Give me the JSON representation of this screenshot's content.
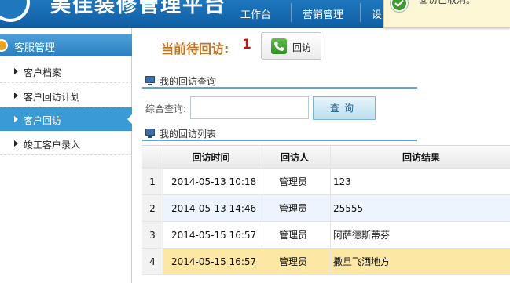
{
  "header": {
    "title": "美佳装修管理平台",
    "nav": [
      {
        "label": "工作台"
      },
      {
        "label": "营销管理"
      },
      {
        "label": "设"
      }
    ]
  },
  "toast": {
    "text": "回访已取消。"
  },
  "sidebar": {
    "header": "客服管理",
    "items": [
      {
        "label": "客户档案"
      },
      {
        "label": "客户回访计划"
      },
      {
        "label": "客户回访",
        "active": true
      },
      {
        "label": "竣工客户录入"
      }
    ]
  },
  "main": {
    "pending_label": "当前待回访",
    "pending_sep": ":",
    "pending_count": "1",
    "visit_button": "回访",
    "query_section": "我的回访查询",
    "search_label": "综合查询:",
    "search_value": "",
    "search_button": "查询",
    "list_section": "我的回访列表"
  },
  "table": {
    "columns": [
      "回访时间",
      "回访人",
      "回访结果"
    ],
    "rows": [
      {
        "idx": "1",
        "time": "2014-05-13 10:18",
        "person": "管理员",
        "result": "123"
      },
      {
        "idx": "2",
        "time": "2014-05-13 14:46",
        "person": "管理员",
        "result": "25555"
      },
      {
        "idx": "3",
        "time": "2014-05-15 16:57",
        "person": "管理员",
        "result": "阿萨德斯蒂芬"
      },
      {
        "idx": "4",
        "time": "2014-05-15 16:57",
        "person": "管理员",
        "result": "撒旦飞洒地方"
      }
    ]
  },
  "colors": {
    "header_blue": "#1f77bd",
    "sidebar_active": "#3a9ad6",
    "pending_orange": "#c8731a",
    "pending_red": "#c0150e",
    "row_highlight": "#fce7a4"
  },
  "icons": [
    "logo-icon",
    "check-circle-icon",
    "menu-circle-icon",
    "arrow-right-icon",
    "phone-icon",
    "monitor-icon"
  ]
}
